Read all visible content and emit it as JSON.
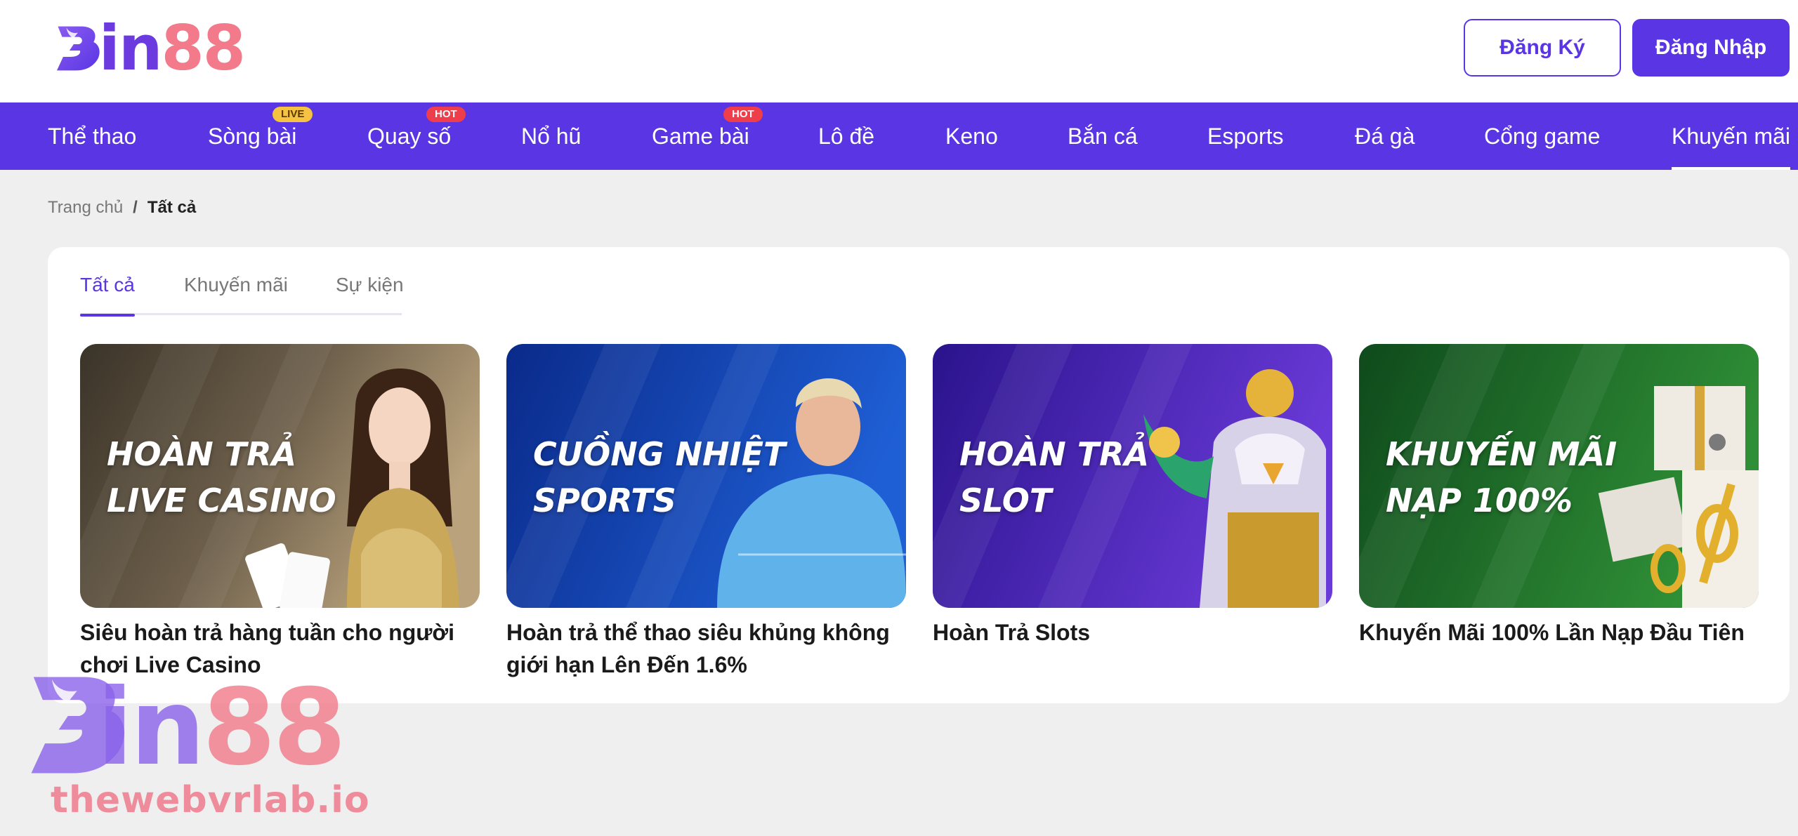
{
  "logo": {
    "text_b": "B",
    "text_in": "in",
    "text_88": "88"
  },
  "auth": {
    "register_label": "Đăng Ký",
    "login_label": "Đăng Nhập"
  },
  "nav": {
    "items": [
      {
        "label": "Thể thao"
      },
      {
        "label": "Sòng bài",
        "badge": "LIVE"
      },
      {
        "label": "Quay số",
        "badge": "HOT"
      },
      {
        "label": "Nổ hũ"
      },
      {
        "label": "Game bài",
        "badge": "HOT"
      },
      {
        "label": "Lô đề"
      },
      {
        "label": "Keno"
      },
      {
        "label": "Bắn cá"
      },
      {
        "label": "Esports"
      },
      {
        "label": "Đá gà"
      },
      {
        "label": "Cổng game"
      },
      {
        "label": "Khuyến mãi",
        "active": true
      }
    ]
  },
  "breadcrumb": {
    "home": "Trang chủ",
    "separator": "/",
    "current": "Tất cả"
  },
  "tabs": [
    {
      "label": "Tất cả",
      "active": true
    },
    {
      "label": "Khuyến mãi"
    },
    {
      "label": "Sự kiện"
    }
  ],
  "cards": [
    {
      "banner_line1": "Hoàn trả",
      "banner_line2": "Live Casino",
      "title": "Siêu hoàn trả hàng tuần cho người chơi Live Casino",
      "color_from": "#3a3328",
      "color_to": "#b9a27c"
    },
    {
      "banner_line1": "Cuồng nhiệt",
      "banner_line2": "Sports",
      "title": "Hoàn trả thể thao siêu khủng không giới hạn Lên Đến 1.6%",
      "color_from": "#0a2a8a",
      "color_to": "#1f5fd6"
    },
    {
      "banner_line1": "Hoàn trả",
      "banner_line2": "Slot",
      "title": "Hoàn Trả Slots",
      "color_from": "#2a138c",
      "color_to": "#6a3ad8"
    },
    {
      "banner_line1": "Khuyến mãi",
      "banner_line2": "Nạp 100%",
      "title": "Khuyến Mãi 100% Lần Nạp Đầu Tiên",
      "color_from": "#0f4a1c",
      "color_to": "#2f8f36"
    }
  ],
  "watermark": {
    "site": "thewebvrlab.io"
  },
  "colors": {
    "brand_purple": "#5a35e4",
    "accent_pink": "#f27a8a",
    "badge_live": "#f5c242",
    "badge_hot": "#ee3e4c"
  }
}
